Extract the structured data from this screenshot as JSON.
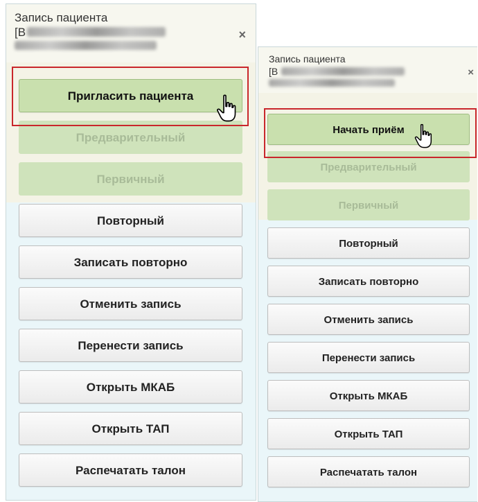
{
  "left_panel": {
    "title": "Запись пациента",
    "patient_id_prefix": "[B",
    "close_label": "×",
    "buttons": {
      "invite": "Пригласить пациента",
      "preliminary": "Предварительный",
      "primary": "Первичный",
      "repeat": "Повторный",
      "reschedule_repeat": "Записать повторно",
      "cancel": "Отменить запись",
      "move": "Перенести запись",
      "open_mkab": "Открыть МКАБ",
      "open_tap": "Открыть ТАП",
      "print_ticket": "Распечатать талон"
    }
  },
  "right_panel": {
    "title": "Запись пациента",
    "patient_id_prefix": "[B",
    "close_label": "×",
    "buttons": {
      "start": "Начать приём",
      "preliminary": "Предварительный",
      "primary": "Первичный",
      "repeat": "Повторный",
      "reschedule_repeat": "Записать повторно",
      "cancel": "Отменить запись",
      "move": "Перенести запись",
      "open_mkab": "Открыть МКАБ",
      "open_tap": "Открыть ТАП",
      "print_ticket": "Распечатать талон"
    }
  },
  "colors": {
    "highlight": "#c9262b",
    "primary_button": "#c9e0ae",
    "disabled_button": "#cfe3bb",
    "panel_background": "#eaf6f9"
  },
  "icons": {
    "cursor": "hand-pointer-icon",
    "close": "close-icon"
  }
}
